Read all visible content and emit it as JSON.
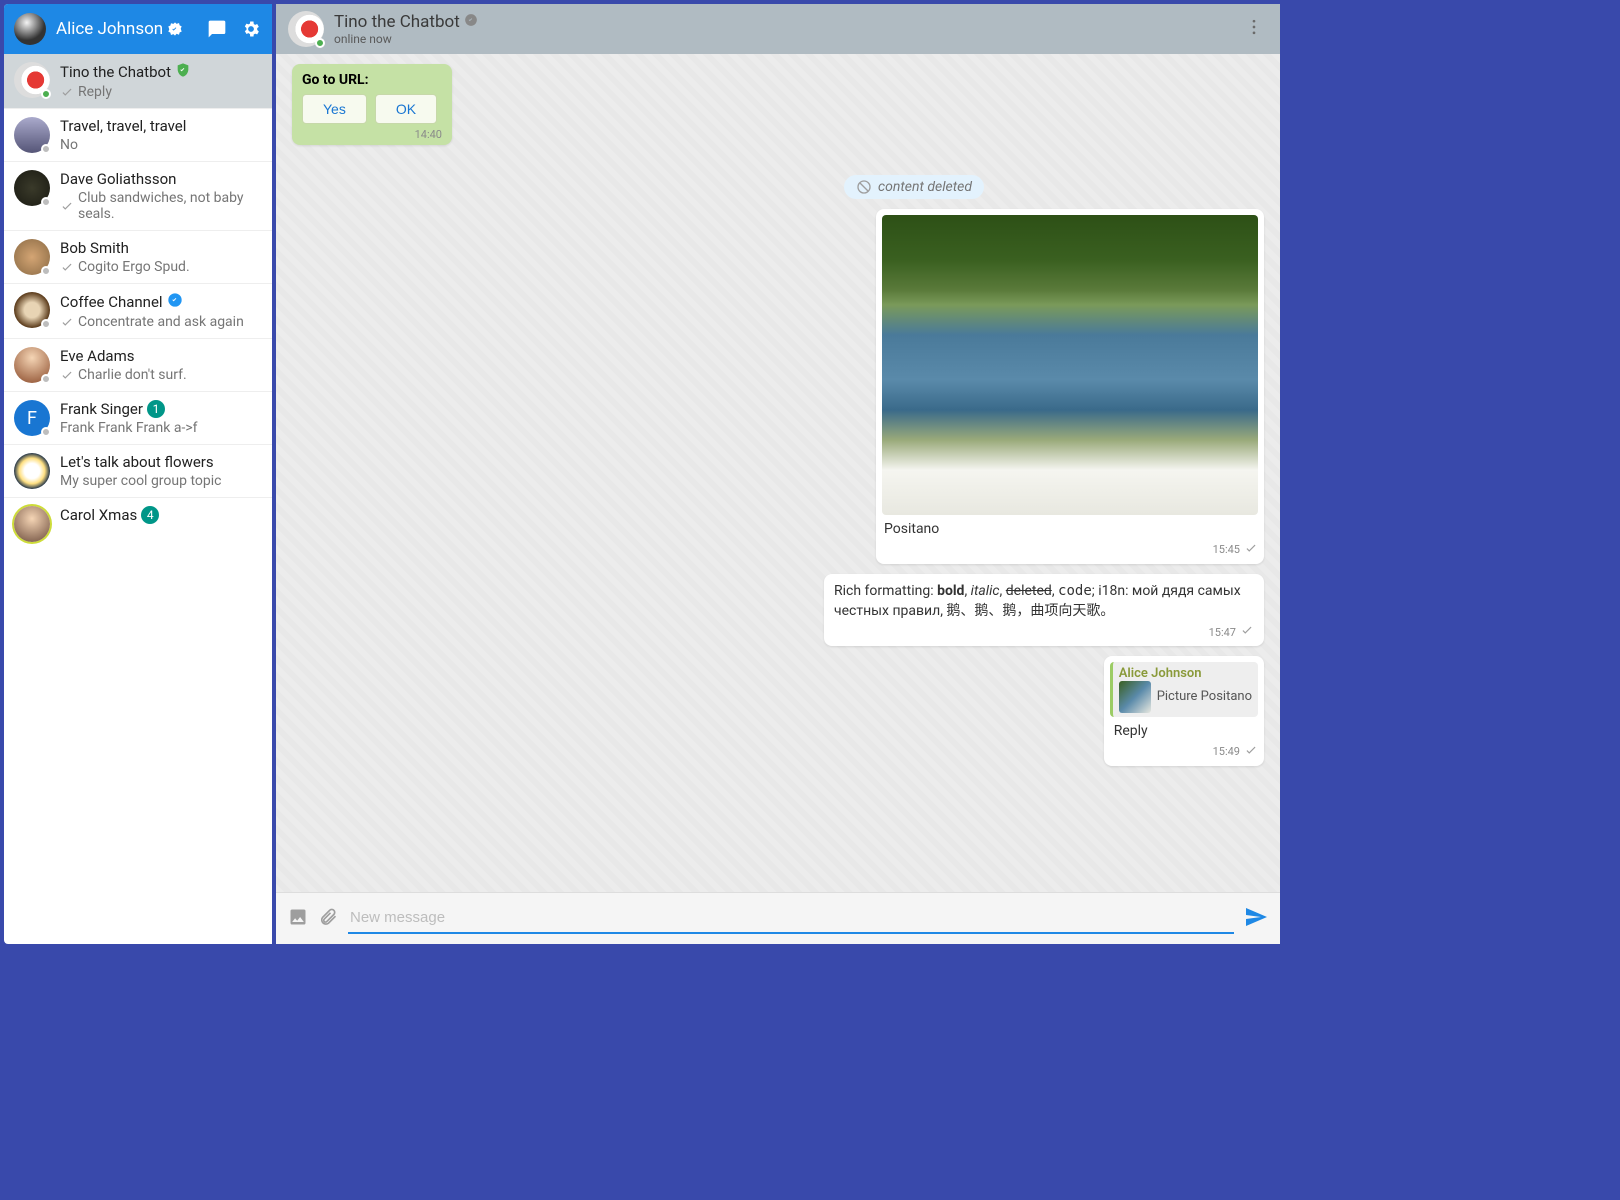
{
  "sidebar": {
    "user_name": "Alice Johnson",
    "chats": [
      {
        "title": "Tino the Chatbot",
        "subtitle": "Reply",
        "has_check": true,
        "badge_type": "shield",
        "active": true
      },
      {
        "title": "Travel, travel, travel",
        "subtitle": "No",
        "has_check": false
      },
      {
        "title": "Dave Goliathsson",
        "subtitle": "Club sandwiches, not baby seals.",
        "has_check": true
      },
      {
        "title": "Bob Smith",
        "subtitle": "Cogito Ergo Spud.",
        "has_check": true
      },
      {
        "title": "Coffee Channel",
        "subtitle": "Concentrate and ask again",
        "has_check": true,
        "badge_type": "blue"
      },
      {
        "title": "Eve Adams",
        "subtitle": "Charlie don't surf.",
        "has_check": true
      },
      {
        "title": "Frank Singer",
        "subtitle": "Frank Frank Frank a->f",
        "has_check": false,
        "unread": "1"
      },
      {
        "title": "Let's talk about flowers",
        "subtitle": "My super cool group topic",
        "has_check": false
      },
      {
        "title": "Carol Xmas",
        "subtitle": "",
        "has_check": false,
        "unread": "4"
      }
    ],
    "frank_letter": "F"
  },
  "header": {
    "title": "Tino the Chatbot",
    "status": "online now"
  },
  "messages": {
    "goto_label": "Go to URL:",
    "btn_yes": "Yes",
    "btn_ok": "OK",
    "goto_time": "14:40",
    "deleted_text": "content deleted",
    "image_caption": "Positano",
    "image_time": "15:45",
    "rich_prefix": "Rich formatting: ",
    "rich_bold": "bold",
    "rich_sep1": ", ",
    "rich_italic": "italic",
    "rich_sep2": ", ",
    "rich_strike": "deleted",
    "rich_sep3": ", ",
    "rich_code": "code",
    "rich_sep4": "; i18n: мой дядя самых честных правил, 鹅、鹅、鹅，曲项向天歌。",
    "rich_time": "15:47",
    "reply_from": "Alice Johnson",
    "reply_snippet": "Picture Positano",
    "reply_body": "Reply",
    "reply_time": "15:49"
  },
  "composer": {
    "placeholder": "New message"
  }
}
